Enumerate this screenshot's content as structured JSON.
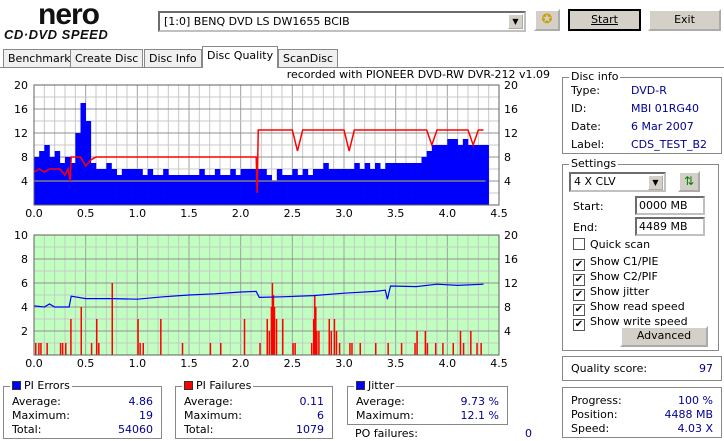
{
  "app": {
    "logo_top": "nero",
    "logo_bottom": "CD·DVD SPEED"
  },
  "toolbar": {
    "drive": "[1:0]  BENQ DVD LS DW1655 BCIB",
    "start_label": "Start",
    "exit_label": "Exit",
    "eject_icon": "disc-tool-icon"
  },
  "tabs": [
    {
      "label": "Benchmark"
    },
    {
      "label": "Create Disc"
    },
    {
      "label": "Disc Info"
    },
    {
      "label": "Disc Quality",
      "active": true
    },
    {
      "label": "ScanDisc"
    }
  ],
  "chart_title": "recorded with PIONEER DVD-RW  DVR-212  v1.09",
  "colors": {
    "pi_errors": "#0000ff",
    "pi_failures": "#ff0000",
    "jitter": "#0000ff",
    "read_speed": "#ff0000",
    "write_speed": "#808080",
    "bottom_bg": "#c0ffc0"
  },
  "chart_data": [
    {
      "type": "bar",
      "xlim": [
        0,
        4.5
      ],
      "ylim": [
        0,
        20
      ],
      "y2lim": [
        0,
        20
      ],
      "xticks": [
        "0.0",
        "0.5",
        "1.0",
        "1.5",
        "2.0",
        "2.5",
        "3.0",
        "3.5",
        "4.0",
        "4.5"
      ],
      "yticks": [
        "4",
        "8",
        "12",
        "16",
        "20"
      ],
      "y2ticks": [
        "4",
        "8",
        "12",
        "16",
        "20"
      ],
      "grid": true,
      "pi_errors_step": 0.05,
      "pi_errors": [
        8,
        9,
        10,
        8,
        9,
        7,
        8,
        7,
        12,
        17,
        14,
        7,
        6,
        6,
        7,
        6,
        5,
        6,
        6,
        6,
        6,
        5,
        6,
        5,
        5,
        6,
        5,
        5,
        5,
        5,
        5,
        5,
        6,
        5,
        5,
        6,
        5,
        5,
        6,
        5,
        6,
        6,
        6,
        6,
        6,
        5,
        4,
        6,
        5,
        5,
        6,
        5,
        6,
        5,
        6,
        6,
        7,
        6,
        6,
        6,
        6,
        6,
        7,
        6,
        7,
        6,
        7,
        6,
        7,
        7,
        7,
        7,
        7,
        7,
        7,
        8,
        9,
        10,
        10,
        10,
        11,
        11,
        10,
        11,
        10,
        10,
        10,
        10
      ],
      "read_speed": [
        [
          0,
          5.5
        ],
        [
          0.05,
          6
        ],
        [
          0.1,
          5.5
        ],
        [
          0.15,
          6
        ],
        [
          0.25,
          6
        ],
        [
          0.3,
          5
        ],
        [
          0.33,
          6
        ],
        [
          0.35,
          4
        ],
        [
          0.36,
          8
        ],
        [
          0.45,
          8
        ],
        [
          0.5,
          6.5
        ],
        [
          0.55,
          7.5
        ],
        [
          0.6,
          8
        ],
        [
          2.15,
          8
        ],
        [
          2.16,
          2
        ],
        [
          2.17,
          12.5
        ],
        [
          2.5,
          12.5
        ],
        [
          2.55,
          9
        ],
        [
          2.6,
          12.5
        ],
        [
          3.0,
          12.5
        ],
        [
          3.05,
          9
        ],
        [
          3.1,
          12.5
        ],
        [
          3.8,
          12.5
        ],
        [
          3.85,
          10
        ],
        [
          3.9,
          12.5
        ],
        [
          4.2,
          12.5
        ],
        [
          4.25,
          10
        ],
        [
          4.3,
          12.5
        ],
        [
          4.35,
          12.5
        ]
      ],
      "write_speed": [
        [
          0,
          4
        ],
        [
          4.37,
          4
        ]
      ]
    },
    {
      "type": "bar",
      "xlim": [
        0,
        4.5
      ],
      "ylim": [
        0,
        10
      ],
      "y2lim": [
        0,
        20
      ],
      "xticks": [
        "0.0",
        "0.5",
        "1.0",
        "1.5",
        "2.0",
        "2.5",
        "3.0",
        "3.5",
        "4.0",
        "4.5"
      ],
      "yticks": [
        "2",
        "4",
        "6",
        "8",
        "10"
      ],
      "y2ticks": [
        "4",
        "8",
        "12",
        "16",
        "20"
      ],
      "grid": true,
      "pi_failures": [
        [
          0.01,
          1
        ],
        [
          0.04,
          1
        ],
        [
          0.06,
          1
        ],
        [
          0.12,
          1
        ],
        [
          0.25,
          1
        ],
        [
          0.27,
          1
        ],
        [
          0.3,
          1
        ],
        [
          0.35,
          3
        ],
        [
          0.45,
          4
        ],
        [
          0.55,
          1
        ],
        [
          0.6,
          3
        ],
        [
          0.62,
          1
        ],
        [
          0.75,
          6
        ],
        [
          1.0,
          3
        ],
        [
          1.02,
          1
        ],
        [
          1.05,
          1
        ],
        [
          1.22,
          3
        ],
        [
          1.43,
          1
        ],
        [
          1.7,
          1
        ],
        [
          1.8,
          1
        ],
        [
          2.03,
          3
        ],
        [
          2.18,
          1
        ],
        [
          2.25,
          3
        ],
        [
          2.27,
          2
        ],
        [
          2.29,
          4
        ],
        [
          2.3,
          6
        ],
        [
          2.31,
          5
        ],
        [
          2.32,
          4
        ],
        [
          2.34,
          3
        ],
        [
          2.4,
          3
        ],
        [
          2.5,
          1
        ],
        [
          2.52,
          1
        ],
        [
          2.68,
          1
        ],
        [
          2.7,
          3
        ],
        [
          2.71,
          5
        ],
        [
          2.72,
          4
        ],
        [
          2.73,
          2
        ],
        [
          2.75,
          2
        ],
        [
          2.85,
          3
        ],
        [
          2.87,
          2
        ],
        [
          2.9,
          3
        ],
        [
          2.92,
          2
        ],
        [
          2.95,
          1
        ],
        [
          3.05,
          1
        ],
        [
          3.07,
          1
        ],
        [
          3.15,
          1
        ],
        [
          3.3,
          1
        ],
        [
          3.42,
          1
        ],
        [
          3.55,
          1
        ],
        [
          3.68,
          1
        ],
        [
          3.7,
          2
        ],
        [
          3.78,
          2
        ],
        [
          3.8,
          1
        ],
        [
          3.88,
          1
        ],
        [
          3.95,
          1
        ],
        [
          4.05,
          1
        ],
        [
          4.12,
          2
        ],
        [
          4.15,
          1
        ],
        [
          4.22,
          2
        ],
        [
          4.28,
          1
        ],
        [
          4.32,
          1
        ]
      ],
      "jitter": [
        [
          0,
          8.2
        ],
        [
          0.1,
          8
        ],
        [
          0.15,
          8.5
        ],
        [
          0.2,
          8
        ],
        [
          0.34,
          8
        ],
        [
          0.36,
          9.8
        ],
        [
          0.5,
          9.4
        ],
        [
          0.75,
          9.4
        ],
        [
          1.0,
          9.3
        ],
        [
          1.25,
          9.7
        ],
        [
          1.5,
          10
        ],
        [
          1.75,
          10.2
        ],
        [
          2.0,
          10.5
        ],
        [
          2.15,
          10.6
        ],
        [
          2.18,
          9.6
        ],
        [
          2.4,
          9.7
        ],
        [
          2.7,
          9.9
        ],
        [
          3.0,
          10.3
        ],
        [
          3.3,
          10.6
        ],
        [
          3.4,
          10.8
        ],
        [
          3.42,
          9.3
        ],
        [
          3.45,
          11.5
        ],
        [
          3.7,
          11.4
        ],
        [
          3.9,
          11.8
        ],
        [
          4.1,
          11.6
        ],
        [
          4.35,
          11.8
        ]
      ]
    }
  ],
  "disc_info": {
    "title": "Disc info",
    "rows": [
      {
        "label": "Type:",
        "value": "DVD-R"
      },
      {
        "label": "ID:",
        "value": "MBI 01RG40"
      },
      {
        "label": "Date:",
        "value": "6 Mar 2007"
      },
      {
        "label": "Label:",
        "value": "CDS_TEST_B2"
      }
    ]
  },
  "settings": {
    "title": "Settings",
    "speed": "4 X CLV",
    "start_label": "Start:",
    "start_value": "0000 MB",
    "end_label": "End:",
    "end_value": "4489 MB",
    "checks": [
      {
        "label": "Quick scan",
        "checked": false
      },
      {
        "label": "Show C1/PIE",
        "checked": true
      },
      {
        "label": "Show C2/PIF",
        "checked": true
      },
      {
        "label": "Show jitter",
        "checked": true
      },
      {
        "label": "Show read speed",
        "checked": true
      },
      {
        "label": "Show write speed",
        "checked": true
      }
    ],
    "advanced_label": "Advanced"
  },
  "quality": {
    "label": "Quality score:",
    "value": "97"
  },
  "progress": {
    "rows": [
      {
        "label": "Progress:",
        "value": "100 %"
      },
      {
        "label": "Position:",
        "value": "4488 MB"
      },
      {
        "label": "Speed:",
        "value": "4.03 X"
      }
    ]
  },
  "pi_errors": {
    "title": "PI Errors",
    "rows": [
      {
        "label": "Average:",
        "value": "4.86"
      },
      {
        "label": "Maximum:",
        "value": "19"
      },
      {
        "label": "Total:",
        "value": "54060"
      }
    ]
  },
  "pi_failures": {
    "title": "PI Failures",
    "rows": [
      {
        "label": "Average:",
        "value": "0.11"
      },
      {
        "label": "Maximum:",
        "value": "6"
      },
      {
        "label": "Total:",
        "value": "1079"
      }
    ]
  },
  "jitter": {
    "title": "Jitter",
    "rows": [
      {
        "label": "Average:",
        "value": "9.73 %"
      },
      {
        "label": "Maximum:",
        "value": "12.1 %"
      }
    ]
  },
  "po_failures": {
    "label": "PO failures:",
    "value": "0"
  }
}
